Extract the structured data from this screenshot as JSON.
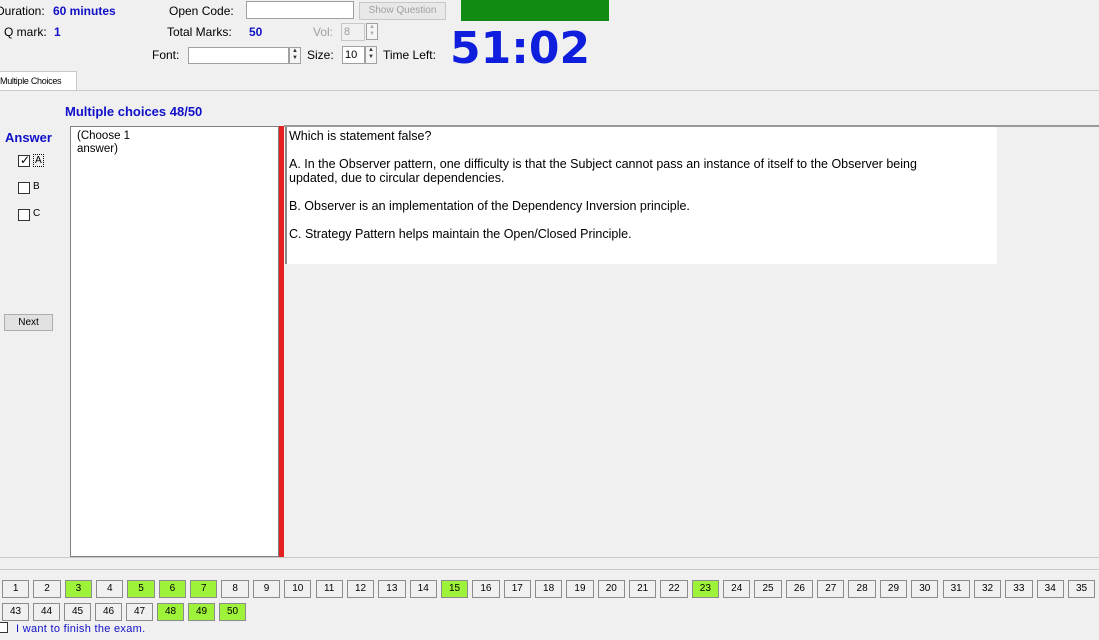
{
  "header": {
    "duration_label": "Duration:",
    "duration_value": "60 minutes",
    "qmark_label": "Q mark:",
    "qmark_value": "1",
    "open_code_label": "Open Code:",
    "show_question_button": "Show Question",
    "total_marks_label": "Total Marks:",
    "total_marks_value": "50",
    "vol_label": "Vol:",
    "vol_value": "8",
    "font_label": "Font:",
    "size_label": "Size:",
    "size_value": "10",
    "time_left_label": "Time Left:",
    "timer": "51:02",
    "status_color": "#128b12"
  },
  "tab": {
    "label": "Multiple Choices"
  },
  "section_title": "Multiple choices 48/50",
  "answer_panel": {
    "title": "Answer",
    "options": [
      {
        "label": "A",
        "checked": true
      },
      {
        "label": "B",
        "checked": false
      },
      {
        "label": "C",
        "checked": false
      }
    ],
    "next_button": "Next"
  },
  "choose_hint": "(Choose 1 answer)",
  "question": {
    "prompt": "Which is statement false?",
    "options": [
      "A.  In the Observer pattern, one difficulty is that the Subject cannot pass an instance of itself to the Observer being updated, due to circular dependencies.",
      "B.  Observer is an implementation of the Dependency Inversion principle.",
      "C.  Strategy Pattern helps maintain the Open/Closed Principle."
    ]
  },
  "navigation": {
    "row1": [
      "1",
      "2",
      "3",
      "4",
      "5",
      "6",
      "7",
      "8",
      "9",
      "10",
      "11",
      "12",
      "13",
      "14",
      "15",
      "16",
      "17",
      "18",
      "19",
      "20",
      "21",
      "22",
      "23",
      "24",
      "25",
      "26",
      "27",
      "28",
      "29",
      "30",
      "31",
      "32",
      "33",
      "34",
      "35"
    ],
    "row2": [
      "43",
      "44",
      "45",
      "46",
      "47",
      "48",
      "49",
      "50"
    ],
    "answered": [
      "3",
      "5",
      "6",
      "7",
      "15",
      "23",
      "48",
      "49",
      "50"
    ],
    "answered_color": "#9ef23a"
  },
  "finish": {
    "label": "I want to finish the exam."
  }
}
